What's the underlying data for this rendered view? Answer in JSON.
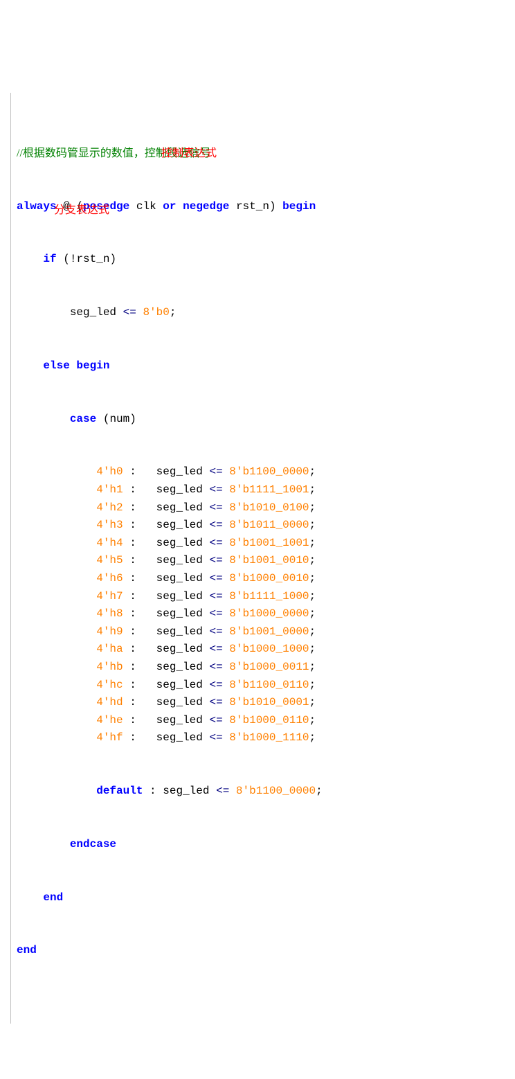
{
  "comment_line": "//根据数码管显示的数值，控制段选信号",
  "always_line": {
    "kw_always": "always",
    "at": "@",
    "paren_open": "(",
    "kw_posedge": "posedge",
    "clk": "clk",
    "kw_or": "or",
    "kw_negedge": "negedge",
    "rstn": "rst_n",
    "paren_close": ")",
    "kw_begin": "begin"
  },
  "if_line": {
    "kw_if": "if",
    "paren_open": "(",
    "bang": "!",
    "rstn": "rst_n",
    "paren_close": ")"
  },
  "reset_line": {
    "seg": "seg_led",
    "le": "<=",
    "val": "8'b0",
    "semi": ";"
  },
  "else_line": {
    "kw_else": "else",
    "kw_begin": "begin"
  },
  "case_line": {
    "kw_case": "case",
    "paren_open": "(",
    "num": "num",
    "paren_close": ")"
  },
  "cases": [
    {
      "sel": "4'h0",
      "val": "8'b1100_0000"
    },
    {
      "sel": "4'h1",
      "val": "8'b1111_1001"
    },
    {
      "sel": "4'h2",
      "val": "8'b1010_0100"
    },
    {
      "sel": "4'h3",
      "val": "8'b1011_0000"
    },
    {
      "sel": "4'h4",
      "val": "8'b1001_1001"
    },
    {
      "sel": "4'h5",
      "val": "8'b1001_0010"
    },
    {
      "sel": "4'h6",
      "val": "8'b1000_0010"
    },
    {
      "sel": "4'h7",
      "val": "8'b1111_1000"
    },
    {
      "sel": "4'h8",
      "val": "8'b1000_0000"
    },
    {
      "sel": "4'h9",
      "val": "8'b1001_0000"
    },
    {
      "sel": "4'ha",
      "val": "8'b1000_1000"
    },
    {
      "sel": "4'hb",
      "val": "8'b1000_0011"
    },
    {
      "sel": "4'hc",
      "val": "8'b1100_0110"
    },
    {
      "sel": "4'hd",
      "val": "8'b1010_0001"
    },
    {
      "sel": "4'he",
      "val": "8'b1000_0110"
    },
    {
      "sel": "4'hf",
      "val": "8'b1000_1110"
    }
  ],
  "default_line": {
    "kw_default": "default",
    "seg": "seg_led",
    "le": "<=",
    "val": "8'b1100_0000",
    "semi": ";"
  },
  "case_item": {
    "seg": "seg_led",
    "le": "<=",
    "colon": ":",
    "semi": ";"
  },
  "kw_endcase": "endcase",
  "kw_end": "end",
  "annotations": {
    "control_expr": "控制表达式",
    "branch_expr": "分支表达式"
  },
  "fold_markers": {
    "minus": "⊟",
    "bar": "│"
  }
}
